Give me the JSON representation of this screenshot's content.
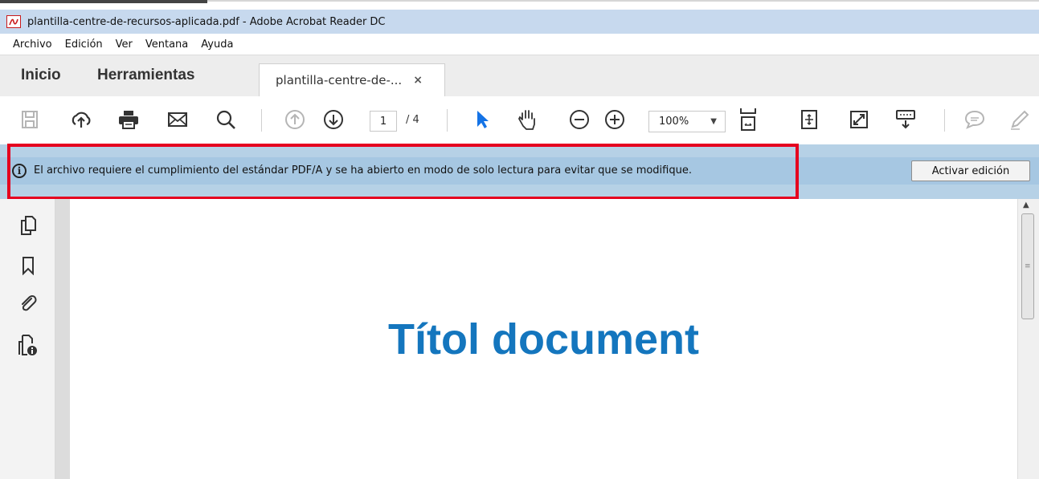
{
  "window": {
    "title": "plantilla-centre-de-recursos-aplicada.pdf - Adobe Acrobat Reader DC",
    "icon": "acrobat-pdf-icon"
  },
  "menu": [
    "Archivo",
    "Edición",
    "Ver",
    "Ventana",
    "Ayuda"
  ],
  "tabs": {
    "home": "Inicio",
    "tools": "Herramientas",
    "document_tab": "plantilla-centre-de-...",
    "close_glyph": "×"
  },
  "toolbar": {
    "icons": [
      "save-icon",
      "upload-cloud-icon",
      "print-icon",
      "email-icon",
      "search-icon",
      "previous-page-icon",
      "next-page-icon",
      "select-cursor-icon",
      "hand-tool-icon",
      "zoom-out-icon",
      "zoom-in-icon",
      "fit-page-icon",
      "scrolling-mode-icon",
      "full-screen-icon",
      "read-mode-icon",
      "comment-icon",
      "pen-icon"
    ],
    "current_page": "1",
    "total_pages": "/ 4",
    "zoom": "100%",
    "zoom_arrow": "▼"
  },
  "infobar": {
    "info_glyph": "i",
    "message": "El archivo requiere el cumplimiento del estándar PDF/A y se ha abierto en modo de solo lectura para evitar que se modifique.",
    "button": "Activar edición",
    "highlight_color": "#e5001f"
  },
  "sidebar": {
    "icons": [
      "page-thumbnails-icon",
      "bookmarks-icon",
      "attachments-icon",
      "document-properties-icon"
    ]
  },
  "document": {
    "heading": "Títol document",
    "heading_color": "#1476be"
  },
  "scrollbar": {
    "up_glyph": "▲",
    "grip_glyph": "≡"
  }
}
